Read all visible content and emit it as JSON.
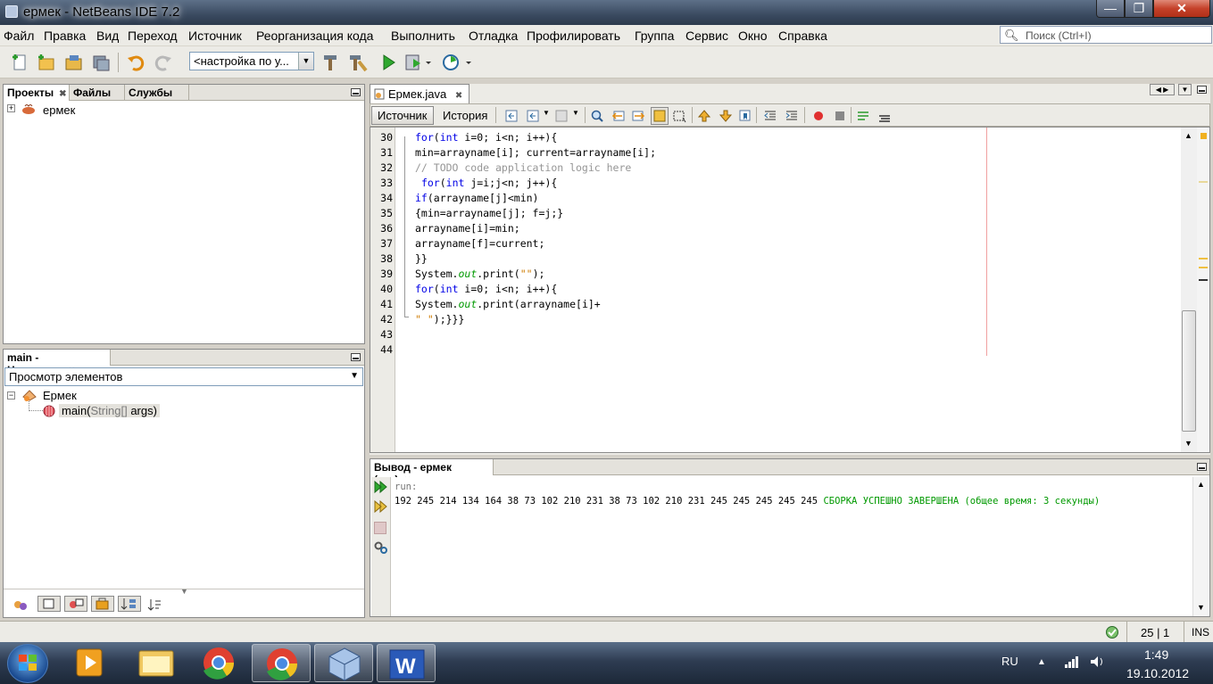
{
  "window": {
    "title": "ермек - NetBeans IDE 7.2",
    "min_glyph": "—",
    "max_glyph": "❐",
    "close_glyph": "✕"
  },
  "menu": [
    "Файл",
    "Правка",
    "Вид",
    "Переход",
    "Источник",
    "Реорганизация кода",
    "Выполнить",
    "Отладка",
    "Профилировать",
    "Группа",
    "Сервис",
    "Окно",
    "Справка"
  ],
  "search": {
    "placeholder": "Поиск (Ctrl+I)",
    "icon": "magnifier-icon"
  },
  "toolbar": {
    "config_value": "<настройка по у..."
  },
  "projects_panel": {
    "tabs": [
      "Проекты",
      "Файлы",
      "Службы"
    ],
    "tree_root": "ермек"
  },
  "navigator": {
    "title": "main - Навигатор",
    "filter": "Просмотр элементов",
    "class_name": "Ермек",
    "method_name": "main(",
    "method_params": "String[]",
    "method_rest": " args)"
  },
  "editor": {
    "file_tab": "Ермек.java",
    "source_button": "Источник",
    "history_button": "История",
    "line_numbers": [
      "30",
      "31",
      "32",
      "33",
      "34",
      "35",
      "36",
      "37",
      "38",
      "39",
      "40",
      "41",
      "42",
      "43",
      "44"
    ]
  },
  "output": {
    "title": "Вывод - ермек (run)",
    "run_label": "run:",
    "result_numbers": "192 245 214 134 164 38 73 102 210 231 38 73 102 210 231 245 245 245 245 245 ",
    "build_message": "СБОРКА УСПЕШНО ЗАВЕРШЕНА (общее время: 3 секунды)"
  },
  "status": {
    "position": "25 | 1",
    "mode": "INS"
  },
  "taskbar": {
    "lang": "RU",
    "time": "1:49",
    "date": "19.10.2012"
  },
  "colors": {
    "keyword": "#0000e6",
    "comment": "#969696",
    "static_field": "#009900",
    "string": "#ce7b00",
    "success": "#009900"
  }
}
